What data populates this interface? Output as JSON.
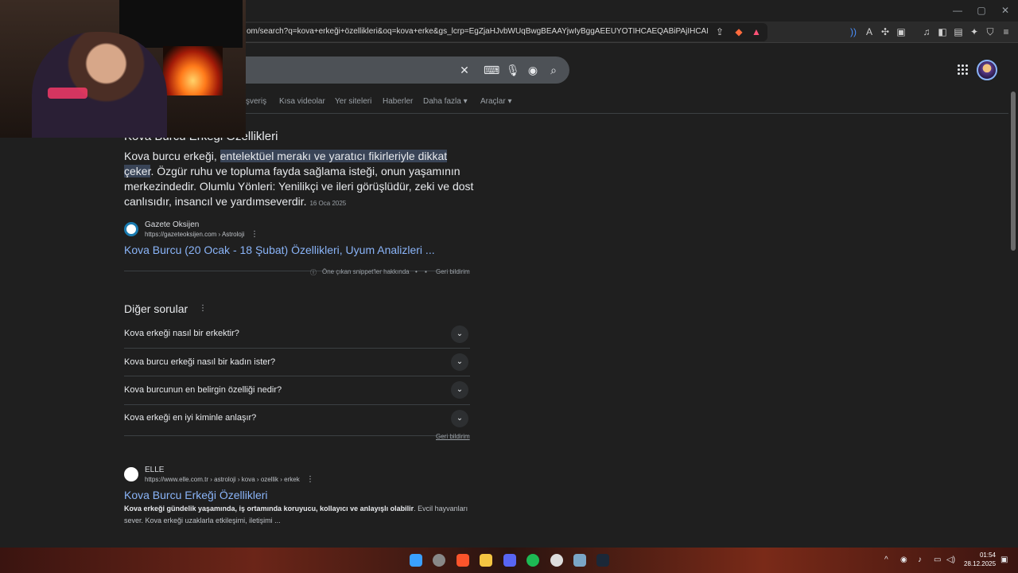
{
  "browser": {
    "url": "om/search?q=kova+erkeği+özellikleri&oq=kova+erke&gs_lcrp=EgZjaHJvbWUqBwgBEAAYjwIyBggAEEUYOTIHCAEQABiPAjIHCAIQABiPAjIHC...",
    "window_controls": {
      "minimize": "—",
      "maximize": "▢",
      "close": "✕"
    }
  },
  "tabs": [
    {
      "label": "şveriş"
    },
    {
      "label": "Kısa videolar"
    },
    {
      "label": "Yer siteleri"
    },
    {
      "label": "Haberler"
    },
    {
      "label": "Daha fazla ▾"
    },
    {
      "label": "Araçlar ▾"
    }
  ],
  "snippet": {
    "title": "Kova Burcu Erkeği Özellikleri",
    "text_before": "Kova burcu erkeği, ",
    "highlight": "entelektüel merakı ve yaratıcı fikirleriyle dikkat çeker",
    "text_after": ". Özgür ruhu ve topluma fayda sağlama isteği, onun yaşamının merkezindedir. Olumlu Yönleri: Yenilikçi ve ileri görüşlüdür, zeki ve dost canlısıdır, insancıl ve yardımseverdir.",
    "date": "16 Oca 2025",
    "source_name": "Gazete Oksijen",
    "source_url": "https://gazeteoksijen.com › Astroloji",
    "link": "Kova Burcu (20 Ocak - 18 Şubat) Özellikleri, Uyum Analizleri ...",
    "about": "Öne çıkan snippet'ler hakkında",
    "feedback": "Geri bildirim"
  },
  "paa": {
    "title": "Diğer sorular",
    "questions": [
      "Kova erkeği nasıl bir erkektir?",
      "Kova burcu erkeği nasıl bir kadın ister?",
      "Kova burcunun en belirgin özelliği nedir?",
      "Kova erkeği en iyi kiminle anlaşır?"
    ],
    "feedback": "Geri bildirim"
  },
  "result2": {
    "source_name": "ELLE",
    "source_url": "https://www.elle.com.tr › astroloji › kova › ozellik › erkek",
    "title": "Kova Burcu Erkeği Özellikleri",
    "snippet_bold": "Kova erkeği gündelik yaşamında, iş ortamında koruyucu, kollayıcı ve anlayışlı olabilir",
    "snippet_rest": ". Evcil hayvanları sever. Kova erkeği uzaklarla etkileşimi, iletişimi ..."
  },
  "taskbar": {
    "time": "01:54",
    "date": "28.12.2025"
  },
  "colors": {
    "background": "#1f1f1f",
    "link": "#8ab4f8",
    "highlight": "#394457"
  }
}
